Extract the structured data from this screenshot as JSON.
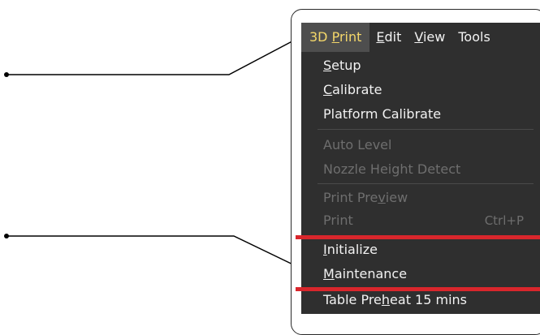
{
  "menubar": {
    "items": [
      {
        "label": "3D Print",
        "mnemonic": "P",
        "active": true
      },
      {
        "label": "Edit",
        "mnemonic": "E"
      },
      {
        "label": "View",
        "mnemonic": "V"
      },
      {
        "label": "Tools"
      }
    ]
  },
  "menu": {
    "groups": [
      [
        {
          "label": "Setup",
          "mnemonic": "S",
          "enabled": true
        },
        {
          "label": "Calibrate",
          "mnemonic": "C",
          "enabled": true
        },
        {
          "label": "Platform Calibrate",
          "enabled": true
        }
      ],
      [
        {
          "label": "Auto Level",
          "enabled": false
        },
        {
          "label": "Nozzle Height Detect",
          "enabled": false
        }
      ],
      [
        {
          "label": "Print Preview",
          "mnemonic": "v",
          "enabled": false
        },
        {
          "label": "Print",
          "shortcut": "Ctrl+P",
          "enabled": false
        }
      ],
      [
        {
          "label": "Initialize",
          "mnemonic": "I",
          "enabled": true
        },
        {
          "label": "Maintenance",
          "mnemonic": "M",
          "enabled": true
        }
      ],
      [
        {
          "label": "Table Preheat 15 mins",
          "mnemonic": "h",
          "enabled": true
        }
      ]
    ]
  },
  "colors": {
    "menu_bg": "#2f2f2f",
    "active_text": "#f4d76a",
    "highlight_line": "#d9262c"
  }
}
